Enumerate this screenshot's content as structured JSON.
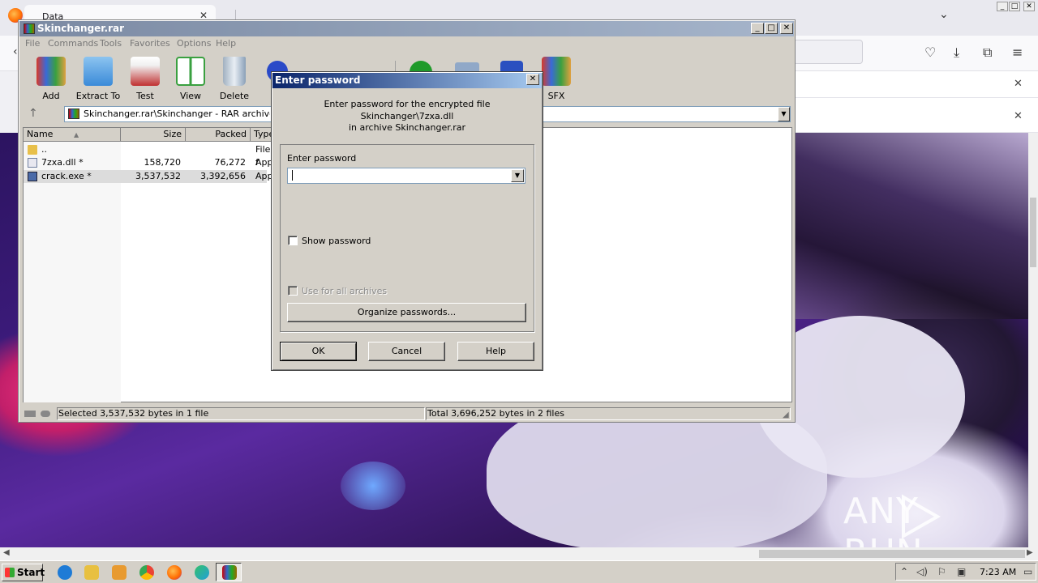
{
  "browser": {
    "tab_title": "Data",
    "tab_close": "✕",
    "list_tabs_icon": "chevron-down-icon",
    "back_icon": "back-arrow-icon",
    "nav_icons": [
      "pocket-icon",
      "download-icon",
      "extensions-icon",
      "menu-icon"
    ],
    "nav_glyphs": [
      "♡",
      "⤓",
      "⧉",
      "≡"
    ],
    "notification_close": "✕"
  },
  "winrar": {
    "title": "Skinchanger.rar",
    "title_buttons": [
      "_",
      "□",
      "✕"
    ],
    "menu": [
      "File",
      "Commands",
      "Tools",
      "Favorites",
      "Options",
      "Help"
    ],
    "toolbar": [
      {
        "label": "Add",
        "icon": "add-archive-icon",
        "color": "#d83a2a"
      },
      {
        "label": "Extract To",
        "icon": "extract-folder-icon",
        "color": "#3a8ad8"
      },
      {
        "label": "Test",
        "icon": "test-clipboard-icon",
        "color": "#c03030"
      },
      {
        "label": "View",
        "icon": "view-book-icon",
        "color": "#3aa040"
      },
      {
        "label": "Delete",
        "icon": "delete-bin-icon",
        "color": "#8aa0b8"
      },
      {
        "label": "SFX",
        "icon": "sfx-icon",
        "color": "#e0a040"
      }
    ],
    "address": "Skinchanger.rar\\Skinchanger - RAR archive, unp",
    "columns": [
      "Name",
      "Size",
      "Packed",
      "Type"
    ],
    "files": [
      {
        "name": "..",
        "size": "",
        "packed": "",
        "type": "File f"
      },
      {
        "name": "7zxa.dll *",
        "size": "158,720",
        "packed": "76,272",
        "type": "Appl"
      },
      {
        "name": "crack.exe *",
        "size": "3,537,532",
        "packed": "3,392,656",
        "type": "Appl"
      }
    ],
    "status_left": "Selected 3,537,532 bytes in 1 file",
    "status_right": "Total 3,696,252 bytes in 2 files"
  },
  "dialog": {
    "title": "Enter password",
    "close": "✕",
    "message_line1": "Enter password for the encrypted file",
    "message_line2": "Skinchanger\\7zxa.dll",
    "message_line3": "in archive Skinchanger.rar",
    "password_label": "Enter password",
    "password_value": "",
    "show_password": "Show password",
    "use_for_all": "Use for all archives",
    "organize": "Organize passwords...",
    "ok": "OK",
    "cancel": "Cancel",
    "help": "Help"
  },
  "watermark": "ANY RUN",
  "taskbar": {
    "start": "Start",
    "apps": [
      "internet-explorer-icon",
      "explorer-folder-icon",
      "media-player-icon",
      "chrome-icon",
      "firefox-icon",
      "edge-icon",
      "winrar-icon"
    ],
    "app_colors": [
      "#1e7bd6",
      "#e8c040",
      "#e89a30",
      "#34a853",
      "#ff7a1a",
      "#1fa0d8",
      "#b03030"
    ],
    "clock": "7:23 AM"
  }
}
